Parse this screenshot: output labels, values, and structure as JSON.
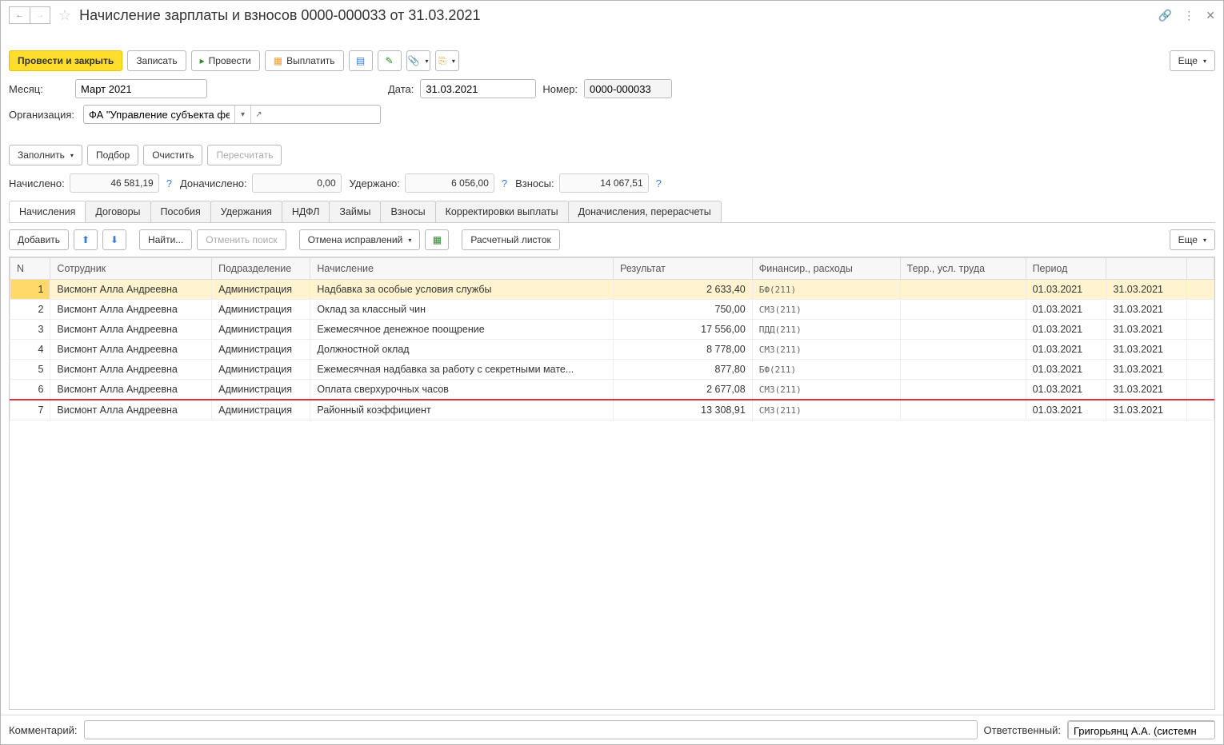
{
  "title": "Начисление зарплаты и взносов 0000-000033 от 31.03.2021",
  "toolbar": {
    "post_close": "Провести и закрыть",
    "save": "Записать",
    "post": "Провести",
    "pay": "Выплатить",
    "more": "Еще"
  },
  "form": {
    "month_label": "Месяц:",
    "month_value": "Март 2021",
    "date_label": "Дата:",
    "date_value": "31.03.2021",
    "number_label": "Номер:",
    "number_value": "0000-000033",
    "org_label": "Организация:",
    "org_value": "ФА \"Управление субъекта федерации\""
  },
  "actions": {
    "fill": "Заполнить",
    "pick": "Подбор",
    "clear": "Очистить",
    "recalc": "Пересчитать"
  },
  "totals": {
    "accrued_label": "Начислено:",
    "accrued_value": "46 581,19",
    "extra_label": "Доначислено:",
    "extra_value": "0,00",
    "withheld_label": "Удержано:",
    "withheld_value": "6 056,00",
    "contrib_label": "Взносы:",
    "contrib_value": "14 067,51"
  },
  "tabs": [
    "Начисления",
    "Договоры",
    "Пособия",
    "Удержания",
    "НДФЛ",
    "Займы",
    "Взносы",
    "Корректировки выплаты",
    "Доначисления, перерасчеты"
  ],
  "tab_toolbar": {
    "add": "Добавить",
    "find": "Найти...",
    "cancel_search": "Отменить поиск",
    "cancel_fix": "Отмена исправлений",
    "payslip": "Расчетный листок",
    "more": "Еще"
  },
  "columns": [
    "N",
    "Сотрудник",
    "Подразделение",
    "Начисление",
    "Результат",
    "Финансир., расходы",
    "Терр., усл. труда",
    "Период",
    "",
    ""
  ],
  "rows": [
    {
      "n": "1",
      "emp": "Висмонт Алла Андреевна",
      "dept": "Администрация",
      "accr": "Надбавка за особые условия службы",
      "res": "2 633,40",
      "fin": "БФ(211)",
      "from": "01.03.2021",
      "to": "31.03.2021"
    },
    {
      "n": "2",
      "emp": "Висмонт Алла Андреевна",
      "dept": "Администрация",
      "accr": "Оклад за классный чин",
      "res": "750,00",
      "fin": "СМЗ(211)",
      "from": "01.03.2021",
      "to": "31.03.2021"
    },
    {
      "n": "3",
      "emp": "Висмонт Алла Андреевна",
      "dept": "Администрация",
      "accr": "Ежемесячное денежное поощрение",
      "res": "17 556,00",
      "fin": "ПДД(211)",
      "from": "01.03.2021",
      "to": "31.03.2021"
    },
    {
      "n": "4",
      "emp": "Висмонт Алла Андреевна",
      "dept": "Администрация",
      "accr": "Должностной оклад",
      "res": "8 778,00",
      "fin": "СМЗ(211)",
      "from": "01.03.2021",
      "to": "31.03.2021"
    },
    {
      "n": "5",
      "emp": "Висмонт Алла Андреевна",
      "dept": "Администрация",
      "accr": "Ежемесячная надбавка за работу с секретными мате...",
      "res": "877,80",
      "fin": "БФ(211)",
      "from": "01.03.2021",
      "to": "31.03.2021"
    },
    {
      "n": "6",
      "emp": "Висмонт Алла Андреевна",
      "dept": "Администрация",
      "accr": "Оплата сверхурочных часов",
      "res": "2 677,08",
      "fin": "СМЗ(211)",
      "from": "01.03.2021",
      "to": "31.03.2021"
    },
    {
      "n": "7",
      "emp": "Висмонт Алла Андреевна",
      "dept": "Администрация",
      "accr": "Районный коэффициент",
      "res": "13 308,91",
      "fin": "СМЗ(211)",
      "from": "01.03.2021",
      "to": "31.03.2021"
    }
  ],
  "footer": {
    "comment_label": "Комментарий:",
    "resp_label": "Ответственный:",
    "resp_value": "Григорьянц А.А. (системн"
  }
}
